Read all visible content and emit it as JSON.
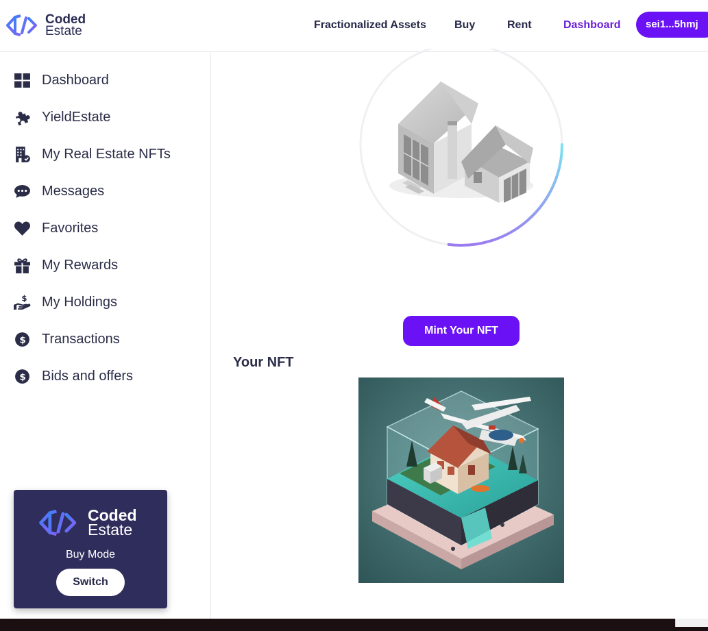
{
  "brand": {
    "line1": "Coded",
    "line2": "Estate"
  },
  "nav": {
    "fractionalized": "Fractionalized Assets",
    "buy": "Buy",
    "rent": "Rent",
    "dashboard": "Dashboard",
    "wallet": "sei1...5hmj"
  },
  "sidebar": {
    "items": [
      {
        "label": "Dashboard",
        "icon": "grid-icon"
      },
      {
        "label": "YieldEstate",
        "icon": "puzzle-icon"
      },
      {
        "label": "My Real Estate NFTs",
        "icon": "building-icon"
      },
      {
        "label": "Messages",
        "icon": "chat-icon"
      },
      {
        "label": "Favorites",
        "icon": "heart-icon"
      },
      {
        "label": "My Rewards",
        "icon": "gift-icon"
      },
      {
        "label": "My Holdings",
        "icon": "hand-dollar-icon"
      },
      {
        "label": "Transactions",
        "icon": "dollar-circle-icon"
      },
      {
        "label": "Bids and offers",
        "icon": "dollar-circle-icon"
      }
    ],
    "mode_card": {
      "brand_line1": "Coded",
      "brand_line2": "Estate",
      "mode": "Buy Mode",
      "switch_label": "Switch"
    }
  },
  "main": {
    "progress": 0.27,
    "mint_label": "Mint Your NFT",
    "your_nft_heading": "Your NFT"
  },
  "colors": {
    "accent": "#6a11f5",
    "active_nav": "#6a1ed8",
    "text_dark": "#262848",
    "card_bg": "#2f2d5c",
    "ring_gradient_start": "#7de3f0",
    "ring_gradient_end": "#9b7cf0"
  }
}
